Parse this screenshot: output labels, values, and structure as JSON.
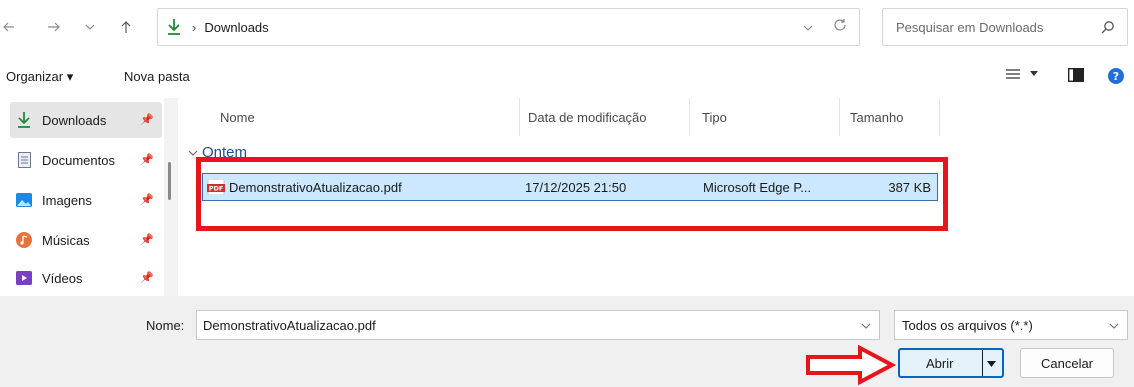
{
  "address": {
    "crumb": "Downloads",
    "separator": "›"
  },
  "search": {
    "placeholder": "Pesquisar em Downloads"
  },
  "toolbar": {
    "organize_label": "Organizar ▾",
    "new_folder_label": "Nova pasta"
  },
  "sidebar": {
    "items": [
      {
        "label": "Downloads",
        "icon": "download-icon"
      },
      {
        "label": "Documentos",
        "icon": "documents-icon"
      },
      {
        "label": "Imagens",
        "icon": "images-icon"
      },
      {
        "label": "Músicas",
        "icon": "music-icon"
      },
      {
        "label": "Vídeos",
        "icon": "videos-icon"
      }
    ]
  },
  "columns": {
    "name": "Nome",
    "modified": "Data de modificação",
    "type": "Tipo",
    "size": "Tamanho"
  },
  "group": {
    "label": "Ontem"
  },
  "files": [
    {
      "name": "DemonstrativoAtualizacao.pdf",
      "modified": "17/12/2025 21:50",
      "type": "Microsoft Edge P...",
      "size": "387 KB",
      "icon": "pdf-icon",
      "icon_text": "PDF"
    }
  ],
  "footer": {
    "name_label": "Nome:",
    "name_value": "DemonstrativoAtualizacao.pdf",
    "filter_value": "Todos os arquivos (*.*)",
    "open_label": "Abrir",
    "cancel_label": "Cancelar"
  },
  "colors": {
    "accent": "#0067c0",
    "selection": "#cce8ff",
    "annotation_red": "#e8141b",
    "download_green": "#1e8a3c"
  }
}
